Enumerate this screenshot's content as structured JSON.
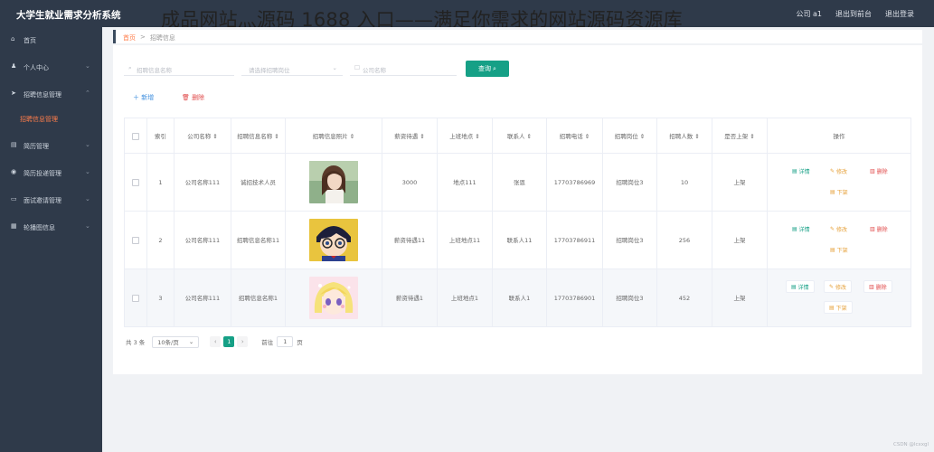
{
  "app": {
    "title": "大学生就业需求分析系统",
    "overlay_title": "成品网站灬源码 1688 入口——满足你需求的网站源码资源库"
  },
  "topbar": {
    "company_user": "公司 a1",
    "back_to_frontend": "退出到前台",
    "logout": "退出登录"
  },
  "sidebar": {
    "items": [
      {
        "label": "首页",
        "icon": "home-icon",
        "glyph": "⌂",
        "has_chevron": false
      },
      {
        "label": "个人中心",
        "icon": "user-icon",
        "glyph": "♟",
        "has_chevron": true
      },
      {
        "label": "招聘信息管理",
        "icon": "send-icon",
        "glyph": "➤",
        "has_chevron": true,
        "expanded": true
      },
      {
        "label": "简历管理",
        "icon": "document-icon",
        "glyph": "▤",
        "has_chevron": true
      },
      {
        "label": "简历投递管理",
        "icon": "compass-icon",
        "glyph": "◉",
        "has_chevron": true
      },
      {
        "label": "面试邀请管理",
        "icon": "message-icon",
        "glyph": "▭",
        "has_chevron": true
      },
      {
        "label": "轮播图信息",
        "icon": "grid-icon",
        "glyph": "▦",
        "has_chevron": true
      }
    ],
    "active_sub": "招聘信息管理"
  },
  "breadcrumb": {
    "home": "首页",
    "separator": ">",
    "current": "招聘信息"
  },
  "search": {
    "company_placeholder": "招聘信息名称",
    "position_placeholder": "请选择招聘岗位",
    "company_name_placeholder": "公司名称",
    "query_label": "查询"
  },
  "actions": {
    "add_label": "新增",
    "delete_label": "删除"
  },
  "table": {
    "columns": [
      "索引",
      "公司名称 ⇕",
      "招聘信息名称 ⇕",
      "招聘信息照片 ⇕",
      "薪资待遇 ⇕",
      "上班地点 ⇕",
      "联系人 ⇕",
      "招聘电话 ⇕",
      "招聘岗位 ⇕",
      "招聘人数 ⇕",
      "是否上架 ⇕",
      "操作"
    ],
    "rows": [
      {
        "index": "1",
        "company": "公司名称111",
        "info_name": "诚招技术人员",
        "photo": "photo-woman-portrait",
        "salary": "3000",
        "location": "地点111",
        "contact": "张恩",
        "phone": "17703786969",
        "position": "招聘岗位3",
        "count": "10",
        "listed": "上架"
      },
      {
        "index": "2",
        "company": "公司名称111",
        "info_name": "招聘信息名称11",
        "photo": "photo-anime-boy-glasses",
        "salary": "薪资待遇11",
        "location": "上班地点11",
        "contact": "联系人11",
        "phone": "17703786911",
        "position": "招聘岗位3",
        "count": "256",
        "listed": "上架"
      },
      {
        "index": "3",
        "company": "公司名称111",
        "info_name": "招聘信息名称1",
        "photo": "photo-anime-girl-blonde",
        "salary": "薪资待遇1",
        "location": "上班地点1",
        "contact": "联系人1",
        "phone": "17703786901",
        "position": "招聘岗位3",
        "count": "452",
        "listed": "上架"
      }
    ],
    "ops": {
      "detail": "详情",
      "edit": "修改",
      "remove": "删除",
      "down": "下架"
    }
  },
  "pagination": {
    "total": "共 3 条",
    "page_size": "10条/页",
    "current_page": "1",
    "goto_label": "前往",
    "goto_value": "1",
    "page_suffix": "页"
  },
  "watermark": "CSDN @lcxxgl",
  "colors": {
    "sidebar_bg": "#2f3a4a",
    "accent_green": "#16a086",
    "accent_orange": "#ff7d4a",
    "danger": "#e04a4a",
    "warning": "#e6a23c",
    "link_blue": "#3c8dde"
  }
}
